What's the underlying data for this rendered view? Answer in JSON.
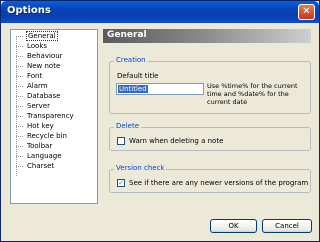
{
  "window": {
    "title": "Options",
    "close_glyph": "✕"
  },
  "nav": {
    "items": [
      {
        "label": "General",
        "selected": true
      },
      {
        "label": "Looks"
      },
      {
        "label": "Behaviour"
      },
      {
        "label": "New note"
      },
      {
        "label": "Font"
      },
      {
        "label": "Alarm"
      },
      {
        "label": "Database"
      },
      {
        "label": "Server"
      },
      {
        "label": "Transparency"
      },
      {
        "label": "Hot key"
      },
      {
        "label": "Recycle bin"
      },
      {
        "label": "Toolbar"
      },
      {
        "label": "Language"
      },
      {
        "label": "Charset"
      }
    ]
  },
  "header": {
    "title": "General"
  },
  "creation": {
    "legend": "Creation",
    "default_title_label": "Default title",
    "default_title_value": "Untitled",
    "hint_line1": "Use %time% for the current",
    "hint_line2": "time and %date% for the",
    "hint_line3": "current date"
  },
  "delete": {
    "legend": "Delete",
    "warn_label": "Warn when deleting a note",
    "warn_checked": false
  },
  "version": {
    "legend": "Version check",
    "check_label": "See if there are any newer versions of the program",
    "check_checked": true,
    "check_mark": "✓"
  },
  "buttons": {
    "ok": "OK",
    "cancel": "Cancel"
  },
  "colors": {
    "title_bar": "#0a52d0",
    "legend_text": "#0046d5",
    "selection": "#316ac5"
  }
}
